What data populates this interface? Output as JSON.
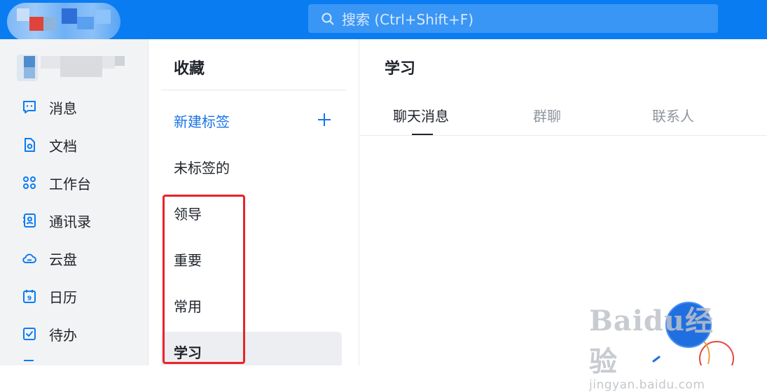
{
  "search": {
    "placeholder": "搜索 (Ctrl+Shift+F)"
  },
  "nav": {
    "items": [
      {
        "label": "消息",
        "icon": "message-icon"
      },
      {
        "label": "文档",
        "icon": "document-icon"
      },
      {
        "label": "工作台",
        "icon": "workbench-icon"
      },
      {
        "label": "通讯录",
        "icon": "contacts-icon"
      },
      {
        "label": "云盘",
        "icon": "cloud-icon"
      },
      {
        "label": "日历",
        "icon": "calendar-icon",
        "badge": "9"
      },
      {
        "label": "待办",
        "icon": "todo-icon"
      }
    ]
  },
  "favorites": {
    "title": "收藏",
    "new_tag_label": "新建标签",
    "tags": [
      "未标签的",
      "领导",
      "重要",
      "常用",
      "学习"
    ],
    "active_tag": "学习"
  },
  "main": {
    "title": "学习",
    "tabs": [
      "聊天消息",
      "群聊",
      "联系人"
    ],
    "active_tab": "聊天消息"
  },
  "watermark": {
    "logo": "Baidu经验",
    "url": "jingyan.baidu.com"
  },
  "colors": {
    "accent": "#0a7cf2",
    "link": "#1a73e8",
    "highlight_box": "#e8232a",
    "nav_bg": "#f2f3f5"
  }
}
